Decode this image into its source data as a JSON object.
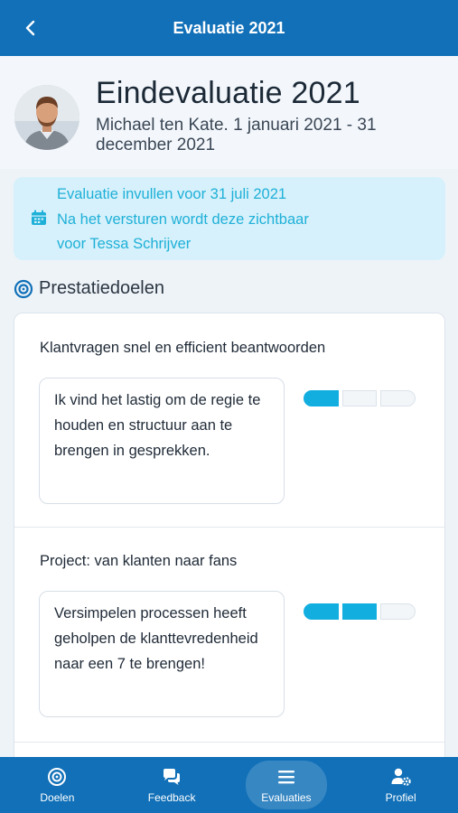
{
  "topbar": {
    "title": "Evaluatie 2021",
    "back_icon": "chevron-left-icon"
  },
  "header": {
    "title": "Eindevaluatie 2021",
    "subtitle": "Michael ten Kate. 1 januari 2021 - 31 december 2021"
  },
  "notice": {
    "icon": "calendar-icon",
    "line1": "Evaluatie invullen voor 31 juli 2021",
    "line2": "Na het versturen wordt deze zichtbaar",
    "line3": "voor Tessa Schrijver"
  },
  "section": {
    "title": "Prestatiedoelen",
    "icon": "target-icon"
  },
  "goals": [
    {
      "title": "Klantvragen snel en efficient beantwoorden",
      "comment": "Ik vind het lastig om de regie te houden en structuur aan te brengen in gesprekken.",
      "rating": 1,
      "rating_max": 3
    },
    {
      "title": "Project: van klanten naar fans",
      "comment": "Versimpelen processen heeft geholpen de klanttevredenheid naar een 7 te brengen!",
      "rating": 2,
      "rating_max": 3
    }
  ],
  "tabs": [
    {
      "label": "Doelen",
      "icon": "target-icon",
      "active": false
    },
    {
      "label": "Feedback",
      "icon": "chat-bubbles-icon",
      "active": false
    },
    {
      "label": "Evaluaties",
      "icon": "list-icon",
      "active": true
    },
    {
      "label": "Profiel",
      "icon": "user-settings-icon",
      "active": false
    }
  ],
  "colors": {
    "primary": "#1170b8",
    "accent": "#12aee0",
    "notice_bg": "#d6f1fb",
    "notice_text": "#1fb0d8"
  }
}
